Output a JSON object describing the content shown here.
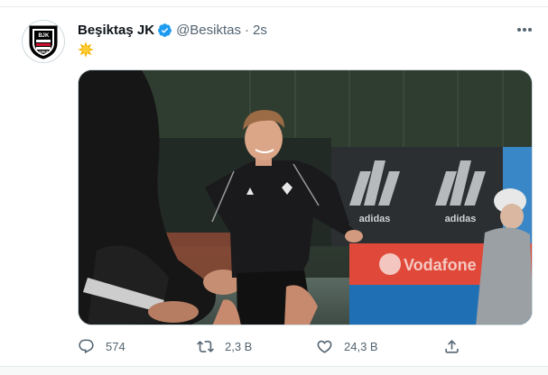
{
  "tweet": {
    "author_name": "Beşiktaş JK",
    "handle": "@Besiktas",
    "separator": "·",
    "timestamp": "2s",
    "avatar": {
      "logo_letters": [
        "B",
        "J",
        "K"
      ],
      "logo_year": "1903"
    },
    "text_emoji": "sun-emoji",
    "media": {
      "sponsor_texts": [
        "adidas",
        "adidas",
        "Vodafone"
      ],
      "description_icon": "photo"
    },
    "actions": {
      "reply_count": "574",
      "retweet_count": "2,3 B",
      "like_count": "24,3 B"
    }
  },
  "colors": {
    "text": "#0f1419",
    "secondary": "#536471",
    "verified": "#1d9bf0",
    "emoji": "#f4b400",
    "divider": "#e6ecf0"
  },
  "icons": {
    "more": "more-icon",
    "reply": "reply-icon",
    "retweet": "retweet-icon",
    "like": "like-icon",
    "share": "share-icon",
    "verified": "verified-badge-icon"
  }
}
